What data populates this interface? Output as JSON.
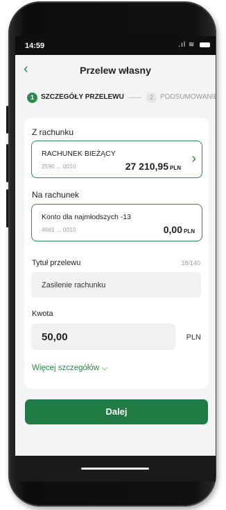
{
  "status_bar": {
    "time": "14:59",
    "signal_icons": "signal-wifi-battery"
  },
  "header": {
    "title": "Przelew własny",
    "back_icon": "chevron-left-icon"
  },
  "stepper": {
    "steps": [
      {
        "number": "1",
        "label": "SZCZEGÓŁY PRZELEWU",
        "active": true
      },
      {
        "number": "2",
        "label": "PODSUMOWANIE",
        "active": false
      }
    ]
  },
  "form": {
    "from_label": "Z rachunku",
    "from_account": {
      "name": "RACHUNEK BIEŻĄCY",
      "number": "2590 ... 0010",
      "amount": "27 210,95",
      "currency": "PLN"
    },
    "to_label": "Na rachunek",
    "to_account": {
      "name": "Konto dla najmłodszych -13",
      "number": "4681 ... 0010",
      "amount": "0,00",
      "currency": "PLN"
    },
    "title_label": "Tytuł przelewu",
    "title_counter": "18/140",
    "title_value": "Zasilenie rachunku",
    "amount_label": "Kwota",
    "amount_value": "50,00",
    "amount_currency": "PLN",
    "more_details": "Więcej szczegółów"
  },
  "actions": {
    "next_label": "Dalej"
  },
  "colors": {
    "accent": "#2d8a4e",
    "button": "#1f7a43",
    "background": "#f3f4f6"
  }
}
